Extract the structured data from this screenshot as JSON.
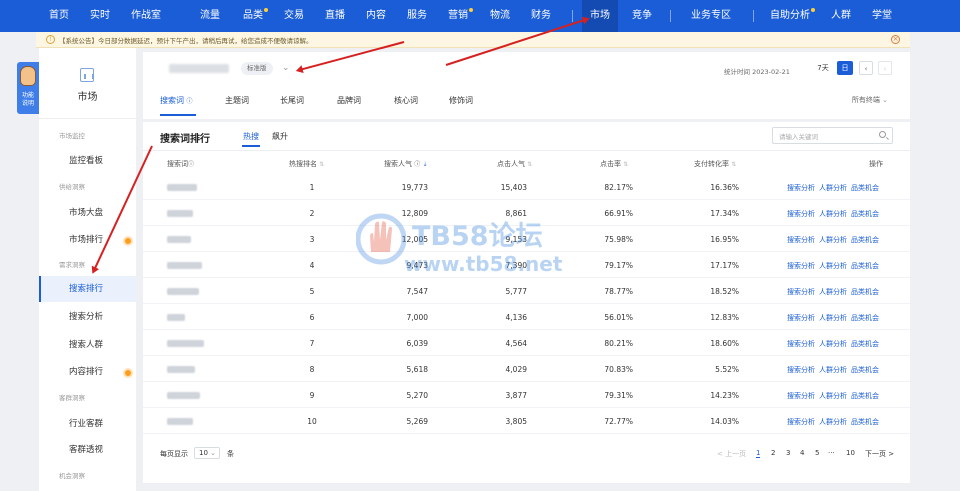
{
  "nav": {
    "items": [
      "首页",
      "实时",
      "作战室",
      "流量",
      "品类",
      "交易",
      "直播",
      "内容",
      "服务",
      "营销",
      "物流",
      "财务",
      "市场",
      "竞争",
      "业务专区",
      "自助分析",
      "人群",
      "学堂"
    ],
    "active": "市场"
  },
  "notice": {
    "text": "【系统公告】今日部分数据延迟，预计下午产出，请稍后再试，给您造成不便敬请谅解。"
  },
  "side_tab": {
    "label_1": "功能",
    "label_2": "说明"
  },
  "sidebar": {
    "title": "市场",
    "groups": [
      {
        "label": "市场监控",
        "items": [
          "监控看板"
        ]
      },
      {
        "label": "供给洞察",
        "items": [
          "市场大盘",
          "市场排行"
        ]
      },
      {
        "label": "需求洞察",
        "items": [
          "搜索排行",
          "搜索分析",
          "搜索人群",
          "内容排行"
        ]
      },
      {
        "label": "客群洞察",
        "items": [
          "行业客群",
          "客群透视"
        ]
      },
      {
        "label": "机会洞察",
        "items": []
      }
    ],
    "active_item": "搜索排行"
  },
  "header": {
    "edition_badge": "标准版",
    "stat_time": "统计时间 2023-02-21",
    "range_7d": "7天",
    "range_day": "日",
    "tabs": [
      "搜索词",
      "主题词",
      "长尾词",
      "品牌词",
      "核心词",
      "修饰词"
    ],
    "active_tab": "搜索词",
    "terminal": "所有终端"
  },
  "ranking": {
    "title": "搜索词排行",
    "tabs": [
      "热搜",
      "飙升"
    ],
    "active_tab": "热搜",
    "search_placeholder": "请输入关键词",
    "columns": [
      "搜索词",
      "热搜排名",
      "搜索人气",
      "点击人气",
      "点击率",
      "支付转化率",
      "操作"
    ],
    "rows": [
      {
        "rank": "1",
        "search_pop": "19,773",
        "click_pop": "15,403",
        "ctr": "82.17%",
        "cvr": "16.36%"
      },
      {
        "rank": "2",
        "search_pop": "12,809",
        "click_pop": "8,861",
        "ctr": "66.91%",
        "cvr": "17.34%"
      },
      {
        "rank": "3",
        "search_pop": "12,005",
        "click_pop": "9,153",
        "ctr": "75.98%",
        "cvr": "16.95%"
      },
      {
        "rank": "4",
        "search_pop": "9,473",
        "click_pop": "7,390",
        "ctr": "79.17%",
        "cvr": "17.17%"
      },
      {
        "rank": "5",
        "search_pop": "7,547",
        "click_pop": "5,777",
        "ctr": "78.77%",
        "cvr": "18.52%"
      },
      {
        "rank": "6",
        "search_pop": "7,000",
        "click_pop": "4,136",
        "ctr": "56.01%",
        "cvr": "12.83%"
      },
      {
        "rank": "7",
        "search_pop": "6,039",
        "click_pop": "4,564",
        "ctr": "80.21%",
        "cvr": "18.60%"
      },
      {
        "rank": "8",
        "search_pop": "5,618",
        "click_pop": "4,029",
        "ctr": "70.83%",
        "cvr": "5.52%"
      },
      {
        "rank": "9",
        "search_pop": "5,270",
        "click_pop": "3,877",
        "ctr": "79.31%",
        "cvr": "14.23%"
      },
      {
        "rank": "10",
        "search_pop": "5,269",
        "click_pop": "3,805",
        "ctr": "72.77%",
        "cvr": "14.03%"
      }
    ],
    "ops": [
      "搜索分析",
      "人群分析",
      "品类机会"
    ]
  },
  "footer": {
    "per_page_label": "每页显示",
    "per_page_value": "10",
    "per_page_unit": "条",
    "prev": "< 上一页",
    "pages": [
      "1",
      "2",
      "3",
      "4",
      "5",
      "···",
      "10"
    ],
    "next": "下一页 >"
  },
  "watermark": {
    "brand": "TB58论坛",
    "url": "www.tb58.net"
  },
  "colors": {
    "primary": "#1a5dd6",
    "arrow": "#d72020",
    "dot": "#ff9d1d"
  }
}
